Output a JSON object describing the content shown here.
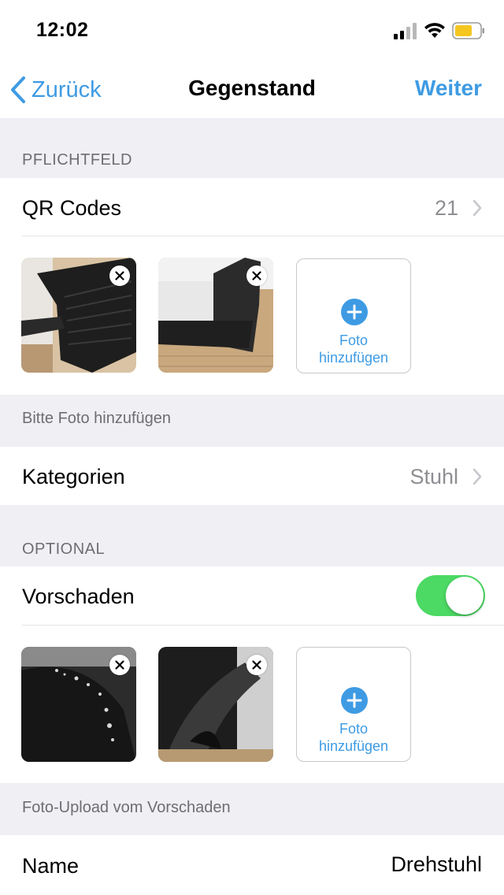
{
  "status_bar": {
    "time": "12:02"
  },
  "nav": {
    "back_label": "Zurück",
    "title": "Gegenstand",
    "next_label": "Weiter"
  },
  "section_required": {
    "header": "PFLICHTFELD",
    "qr_label": "QR Codes",
    "qr_value": "21",
    "add_photo_line1": "Foto",
    "add_photo_line2": "hinzufügen",
    "footer": "Bitte Foto hinzufügen",
    "category_label": "Kategorien",
    "category_value": "Stuhl"
  },
  "section_optional": {
    "header": "OPTIONAL",
    "damage_label": "Vorschaden",
    "damage_enabled": true,
    "add_photo_line1": "Foto",
    "add_photo_line2": "hinzufügen",
    "footer": "Foto-Upload vom Vorschaden",
    "name_label": "Name",
    "name_value": "Drehstuhl"
  },
  "colors": {
    "accent": "#3e9be3",
    "toggle_on": "#4cd964",
    "background": "#efeff4"
  }
}
